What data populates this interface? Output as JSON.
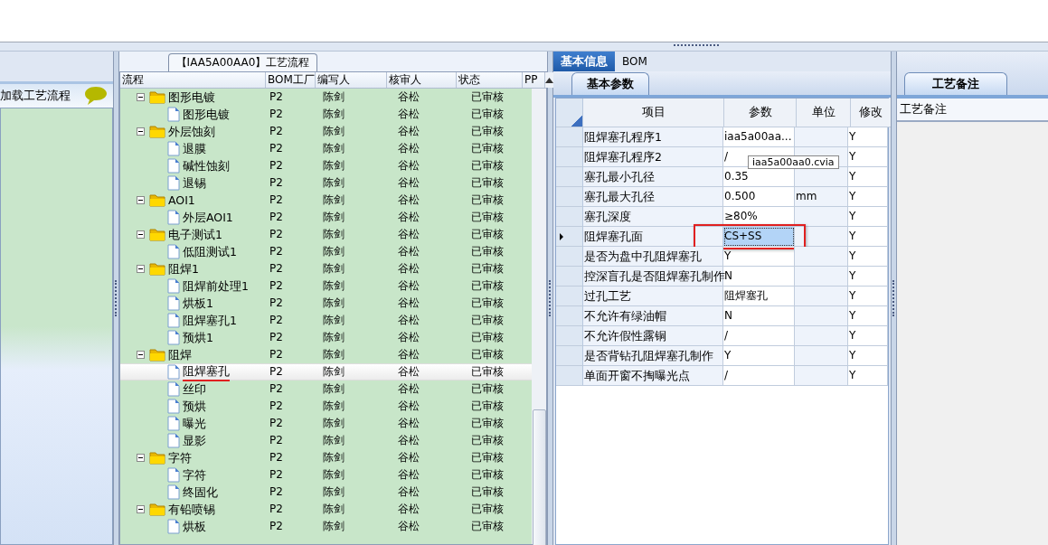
{
  "left_panel": {
    "title": "加载工艺流程"
  },
  "process_panel": {
    "title": "【IAA5A00AA0】工艺流程",
    "columns": [
      "流程",
      "BOM工厂",
      "编写人",
      "核审人",
      "状态",
      "PP"
    ],
    "tree": [
      {
        "label": "图形电镀",
        "bom": "P2",
        "writer": "陈剑",
        "reviewer": "谷松",
        "status": "已审核",
        "selected": false,
        "underlined": false,
        "expanded": true,
        "children": [
          {
            "label": "图形电镀",
            "bom": "P2",
            "writer": "陈剑",
            "reviewer": "谷松",
            "status": "已审核",
            "selected": false,
            "underlined": false
          }
        ]
      },
      {
        "label": "外层蚀刻",
        "bom": "P2",
        "writer": "陈剑",
        "reviewer": "谷松",
        "status": "已审核",
        "selected": false,
        "underlined": false,
        "expanded": true,
        "children": [
          {
            "label": "退膜",
            "bom": "P2",
            "writer": "陈剑",
            "reviewer": "谷松",
            "status": "已审核",
            "selected": false,
            "underlined": false
          },
          {
            "label": "碱性蚀刻",
            "bom": "P2",
            "writer": "陈剑",
            "reviewer": "谷松",
            "status": "已审核",
            "selected": false,
            "underlined": false
          },
          {
            "label": "退锡",
            "bom": "P2",
            "writer": "陈剑",
            "reviewer": "谷松",
            "status": "已审核",
            "selected": false,
            "underlined": false
          }
        ]
      },
      {
        "label": "AOI1",
        "bom": "P2",
        "writer": "陈剑",
        "reviewer": "谷松",
        "status": "已审核",
        "selected": false,
        "underlined": false,
        "expanded": true,
        "children": [
          {
            "label": "外层AOI1",
            "bom": "P2",
            "writer": "陈剑",
            "reviewer": "谷松",
            "status": "已审核",
            "selected": false,
            "underlined": false
          }
        ]
      },
      {
        "label": "电子测试1",
        "bom": "P2",
        "writer": "陈剑",
        "reviewer": "谷松",
        "status": "已审核",
        "selected": false,
        "underlined": false,
        "expanded": true,
        "children": [
          {
            "label": "低阻测试1",
            "bom": "P2",
            "writer": "陈剑",
            "reviewer": "谷松",
            "status": "已审核",
            "selected": false,
            "underlined": false
          }
        ]
      },
      {
        "label": "阻焊1",
        "bom": "P2",
        "writer": "陈剑",
        "reviewer": "谷松",
        "status": "已审核",
        "selected": false,
        "underlined": false,
        "expanded": true,
        "children": [
          {
            "label": "阻焊前处理1",
            "bom": "P2",
            "writer": "陈剑",
            "reviewer": "谷松",
            "status": "已审核",
            "selected": false,
            "underlined": false
          },
          {
            "label": "烘板1",
            "bom": "P2",
            "writer": "陈剑",
            "reviewer": "谷松",
            "status": "已审核",
            "selected": false,
            "underlined": false
          },
          {
            "label": "阻焊塞孔1",
            "bom": "P2",
            "writer": "陈剑",
            "reviewer": "谷松",
            "status": "已审核",
            "selected": false,
            "underlined": false
          },
          {
            "label": "预烘1",
            "bom": "P2",
            "writer": "陈剑",
            "reviewer": "谷松",
            "status": "已审核",
            "selected": false,
            "underlined": false
          }
        ]
      },
      {
        "label": "阻焊",
        "bom": "P2",
        "writer": "陈剑",
        "reviewer": "谷松",
        "status": "已审核",
        "selected": false,
        "underlined": false,
        "expanded": true,
        "children": [
          {
            "label": "阻焊塞孔",
            "bom": "P2",
            "writer": "陈剑",
            "reviewer": "谷松",
            "status": "已审核",
            "selected": true,
            "underlined": true
          },
          {
            "label": "丝印",
            "bom": "P2",
            "writer": "陈剑",
            "reviewer": "谷松",
            "status": "已审核",
            "selected": false,
            "underlined": false
          },
          {
            "label": "预烘",
            "bom": "P2",
            "writer": "陈剑",
            "reviewer": "谷松",
            "status": "已审核",
            "selected": false,
            "underlined": false
          },
          {
            "label": "曝光",
            "bom": "P2",
            "writer": "陈剑",
            "reviewer": "谷松",
            "status": "已审核",
            "selected": false,
            "underlined": false
          },
          {
            "label": "显影",
            "bom": "P2",
            "writer": "陈剑",
            "reviewer": "谷松",
            "status": "已审核",
            "selected": false,
            "underlined": false
          }
        ]
      },
      {
        "label": "字符",
        "bom": "P2",
        "writer": "陈剑",
        "reviewer": "谷松",
        "status": "已审核",
        "selected": false,
        "underlined": false,
        "expanded": true,
        "children": [
          {
            "label": "字符",
            "bom": "P2",
            "writer": "陈剑",
            "reviewer": "谷松",
            "status": "已审核",
            "selected": false,
            "underlined": false
          },
          {
            "label": "终固化",
            "bom": "P2",
            "writer": "陈剑",
            "reviewer": "谷松",
            "status": "已审核",
            "selected": false,
            "underlined": false
          }
        ]
      },
      {
        "label": "有铅喷锡",
        "bom": "P2",
        "writer": "陈剑",
        "reviewer": "谷松",
        "status": "已审核",
        "selected": false,
        "underlined": false,
        "expanded": true,
        "children": [
          {
            "label": "烘板",
            "bom": "P2",
            "writer": "陈剑",
            "reviewer": "谷松",
            "status": "已审核",
            "selected": false,
            "underlined": false
          }
        ]
      }
    ]
  },
  "info_panel": {
    "tabs": [
      {
        "label": "基本信息",
        "selected": true
      },
      {
        "label": "BOM",
        "selected": false
      }
    ],
    "subtab": "基本参数",
    "columns": [
      "项目",
      "参数",
      "单位",
      "修改"
    ],
    "rows": [
      {
        "item": "阻焊塞孔程序1",
        "value": "iaa5a00aa...",
        "unit": "",
        "modify": "Y",
        "current": false,
        "boxed": false
      },
      {
        "item": "阻焊塞孔程序2",
        "value": "/",
        "unit": "",
        "modify": "Y",
        "current": false,
        "boxed": false
      },
      {
        "item": "塞孔最小孔径",
        "value": "0.35",
        "unit": "",
        "modify": "Y",
        "current": false,
        "boxed": false
      },
      {
        "item": "塞孔最大孔径",
        "value": "0.500",
        "unit": "mm",
        "modify": "Y",
        "current": false,
        "boxed": false
      },
      {
        "item": "塞孔深度",
        "value": "≥80%",
        "unit": "",
        "modify": "Y",
        "current": false,
        "boxed": false
      },
      {
        "item": "阻焊塞孔面",
        "value": "CS+SS",
        "unit": "",
        "modify": "Y",
        "current": true,
        "boxed": true
      },
      {
        "item": "是否为盘中孔阻焊塞孔",
        "value": "Y",
        "unit": "",
        "modify": "Y",
        "current": false,
        "boxed": false
      },
      {
        "item": "控深盲孔是否阻焊塞孔制作",
        "value": "N",
        "unit": "",
        "modify": "Y",
        "current": false,
        "boxed": false
      },
      {
        "item": "过孔工艺",
        "value": "阻焊塞孔",
        "unit": "",
        "modify": "Y",
        "current": false,
        "boxed": false
      },
      {
        "item": "不允许有绿油帽",
        "value": "N",
        "unit": "",
        "modify": "Y",
        "current": false,
        "boxed": false
      },
      {
        "item": "不允许假性露铜",
        "value": "/",
        "unit": "",
        "modify": "Y",
        "current": false,
        "boxed": false
      },
      {
        "item": "是否背钻孔阻焊塞孔制作",
        "value": "Y",
        "unit": "",
        "modify": "Y",
        "current": false,
        "boxed": false
      },
      {
        "item": "单面开窗不掏曝光点",
        "value": "/",
        "unit": "",
        "modify": "Y",
        "current": false,
        "boxed": false
      }
    ],
    "tooltip": "iaa5a00aa0.cvia"
  },
  "notes_panel": {
    "tab": "工艺备注",
    "header": "工艺备注"
  }
}
